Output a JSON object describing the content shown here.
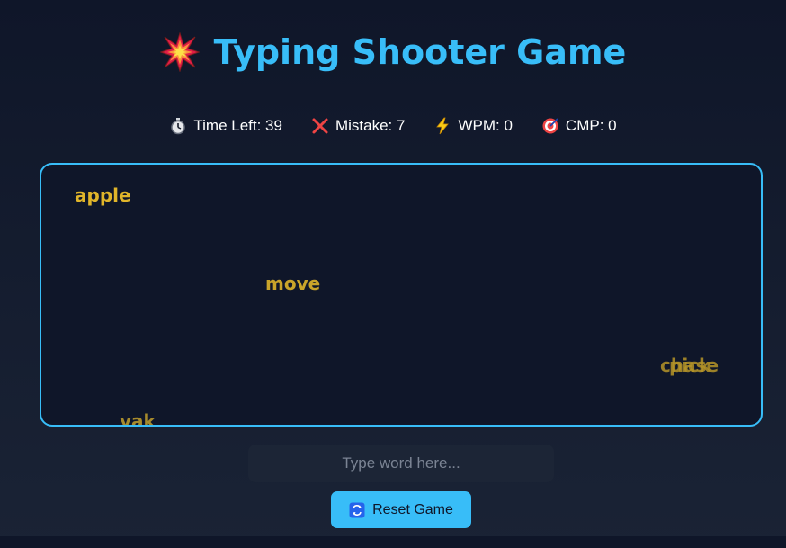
{
  "title": "Typing Shooter Game",
  "title_icon": "collision-icon",
  "stats": {
    "time_left": "Time Left: 39",
    "mistake": "Mistake: 7",
    "wpm": "WPM: 0",
    "cmp": "CMP: 0"
  },
  "words": [
    "apple",
    "move",
    "chase",
    "pick",
    "yak"
  ],
  "input": {
    "value": "",
    "placeholder": "Type word here..."
  },
  "reset_button": {
    "label": "Reset Game",
    "icon": "refresh-icon"
  },
  "colors": {
    "accent": "#38bdf8",
    "word": "#e0b52a",
    "background": "#0f1629"
  }
}
